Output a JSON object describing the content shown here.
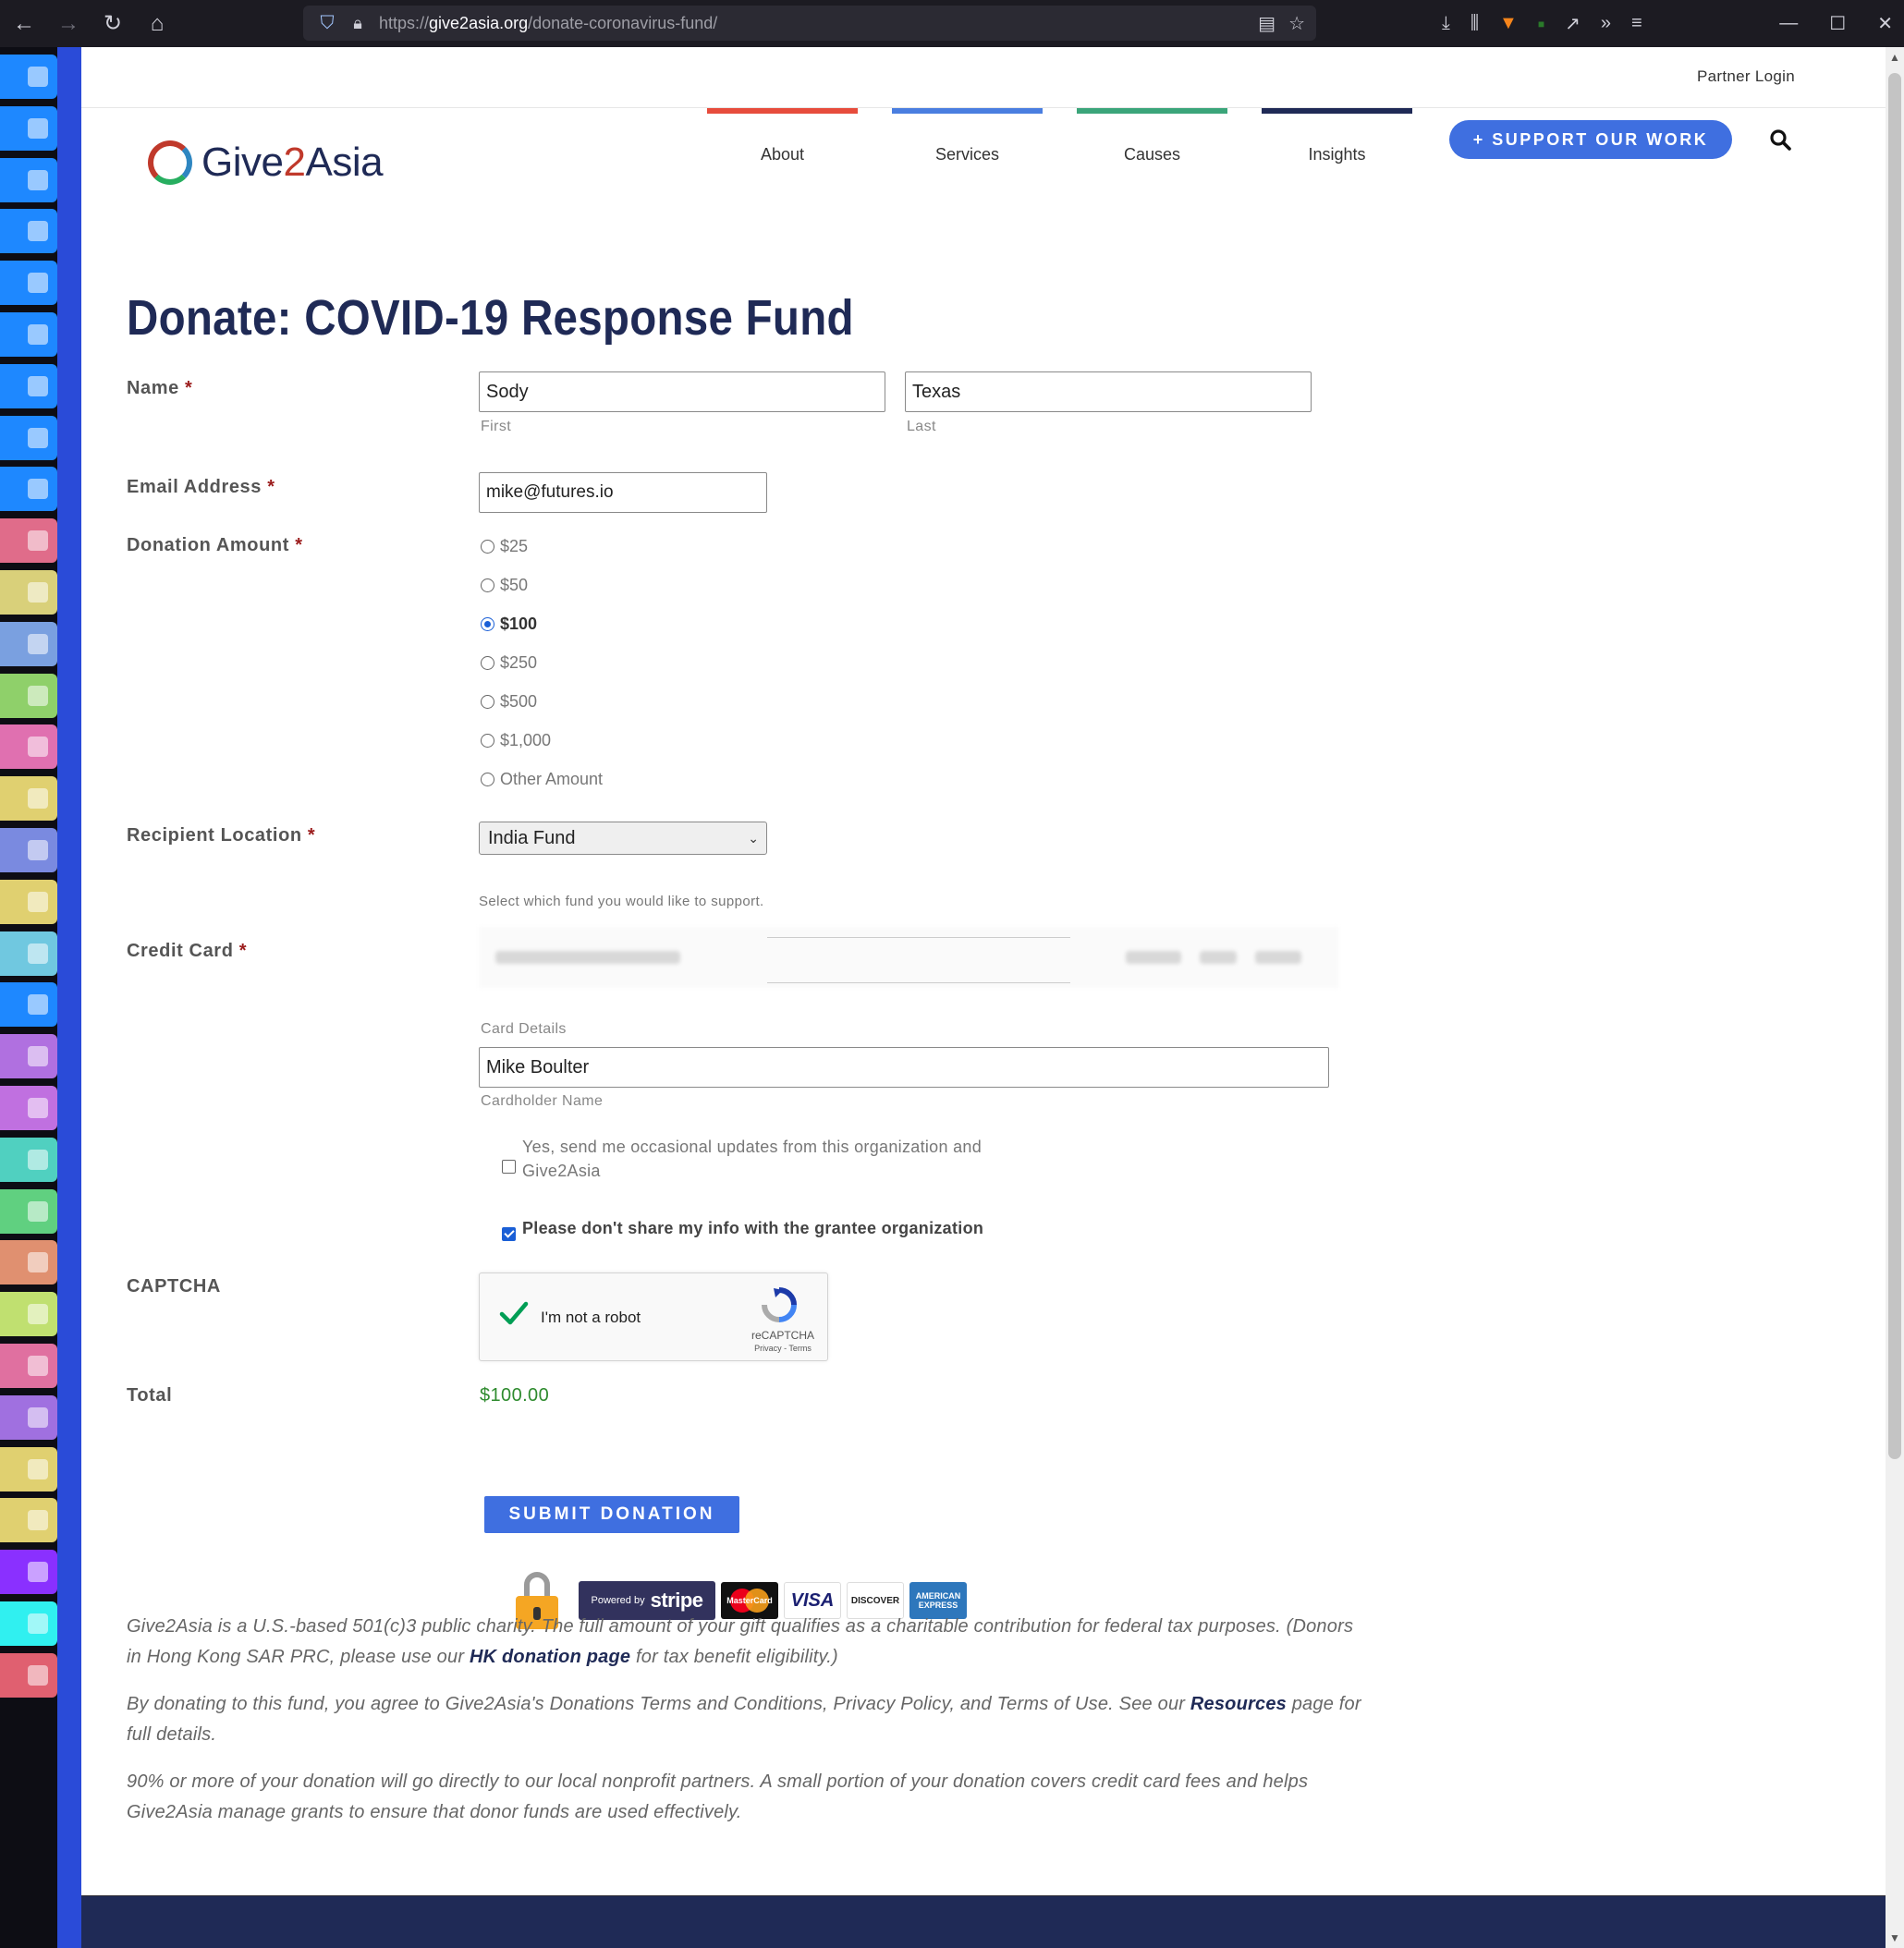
{
  "browser": {
    "url_prefix": "https://",
    "url_domain": "give2asia.org",
    "url_path": "/donate-coronavirus-fund/",
    "icons": {
      "back": "←",
      "forward": "→",
      "reload": "↻",
      "home": "⌂",
      "reader": "▤",
      "bookmark": "☆",
      "download": "⤓",
      "library": "⫼",
      "overflow": "»",
      "menu": "≡",
      "minimize": "—",
      "maximize": "☐",
      "close": "✕"
    }
  },
  "header": {
    "partner_login": "Partner Login",
    "logo_text_a": "Give",
    "logo_text_b": "2",
    "logo_text_c": "Asia",
    "nav": [
      "About",
      "Services",
      "Causes",
      "Insights"
    ],
    "support_button": "+ SUPPORT OUR WORK"
  },
  "form": {
    "title": "Donate: COVID-19 Response Fund",
    "required_marker": "*",
    "name": {
      "label": "Name",
      "first_value": "Sody",
      "first_sublabel": "First",
      "last_value": "Texas",
      "last_sublabel": "Last"
    },
    "email": {
      "label": "Email Address",
      "value": "mike@futures.io"
    },
    "donation": {
      "label": "Donation Amount",
      "options": [
        "$25",
        "$50",
        "$100",
        "$250",
        "$500",
        "$1,000",
        "Other Amount"
      ],
      "selected": "$100"
    },
    "recipient": {
      "label": "Recipient Location",
      "selected": "India Fund",
      "help": "Select which fund you would like to support."
    },
    "credit_card": {
      "label": "Credit Card",
      "card_details_sublabel": "Card Details",
      "cardholder_value": "Mike Boulter",
      "cardholder_sublabel": "Cardholder Name"
    },
    "opt_in_text": "Yes, send me occasional updates from this organization and Give2Asia",
    "opt_in_checked": false,
    "no_share_text": "Please don't share my info with the grantee organization",
    "no_share_checked": true,
    "captcha": {
      "label": "CAPTCHA",
      "text": "I'm not a robot",
      "brand": "reCAPTCHA",
      "links": "Privacy - Terms"
    },
    "total": {
      "label": "Total",
      "value": "$100.00"
    },
    "submit_label": "SUBMIT DONATION"
  },
  "payment": {
    "powered_by": "Powered by",
    "stripe": "stripe",
    "mastercard": "MasterCard",
    "visa": "VISA",
    "discover": "DISCOVER",
    "amex": "AMERICAN EXPRESS"
  },
  "legal": {
    "p1_before": "Give2Asia is a U.S.-based 501(c)3 public charity. The full amount of your gift qualifies as a charitable contribution for federal tax purposes. (Donors in Hong Kong SAR PRC, please use our ",
    "p1_link": "HK donation page",
    "p1_after": " for tax benefit eligibility.)",
    "p2_before": "By donating to this fund, you agree to Give2Asia's Donations Terms and Conditions, Privacy Policy, and Terms of Use. See our ",
    "p2_link": "Resources",
    "p2_after": " page for full details.",
    "p3": "90% or more of your donation will go directly to our local nonprofit partners. A small portion of your donation covers credit card fees and helps Give2Asia manage grants to ensure that donor funds are used effectively."
  },
  "colors": {
    "navy": "#1f2a56",
    "accent_blue": "#3f6fe0",
    "nav_about": "#e74c3c",
    "nav_services": "#4a7ee0",
    "nav_causes": "#3ba57a",
    "nav_insights": "#1f2a56",
    "total_green": "#2e8b2e"
  }
}
